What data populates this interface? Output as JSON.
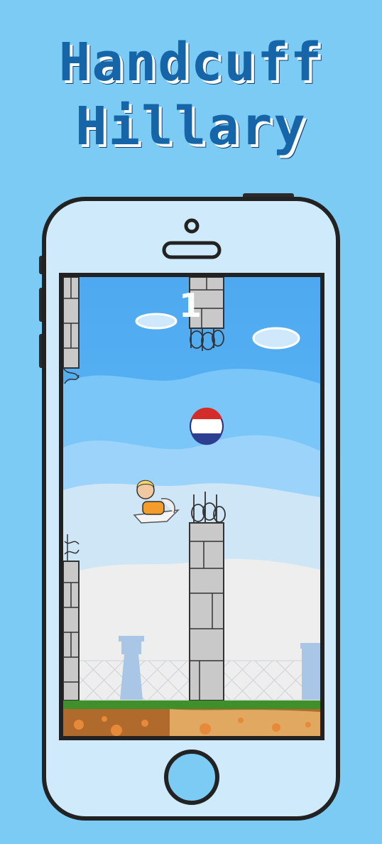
{
  "title": {
    "line1": "Handcuff",
    "line2": "Hillary",
    "color": "#1565a8"
  },
  "game": {
    "score": "1",
    "colors": {
      "background": "#7ccbf5",
      "sky_top": "#4ea9f0",
      "pillar": "#c9c9c9",
      "ground_grass": "#3f8f2a",
      "ground_dirt": "#b06a2b"
    },
    "sprites": {
      "player": "hillary-in-orange-jumpsuit-on-paper-plane",
      "collectible": "netherlands-flag-coin",
      "obstacle": "stone-pillar-with-barbed-wire",
      "background": "prison-yard-with-watchtowers"
    }
  }
}
